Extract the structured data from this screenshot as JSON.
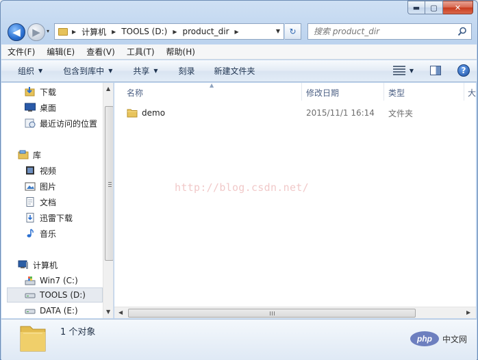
{
  "window": {
    "caption": {
      "minimize": "▬",
      "maximize": "▢",
      "close": "✕"
    }
  },
  "nav": {
    "back_glyph": "◀",
    "forward_glyph": "▶",
    "dropdown_glyph": "▾"
  },
  "address": {
    "segments": [
      "计算机",
      "TOOLS (D:)",
      "product_dir"
    ],
    "separator": "▶",
    "dropdown_glyph": "▼"
  },
  "refresh_glyph": "↻",
  "search": {
    "placeholder": "搜索 product_dir"
  },
  "menubar": {
    "items": [
      "文件(F)",
      "编辑(E)",
      "查看(V)",
      "工具(T)",
      "帮助(H)"
    ]
  },
  "commandbar": {
    "items": [
      {
        "label": "组织",
        "dropdown": true
      },
      {
        "label": "包含到库中",
        "dropdown": true
      },
      {
        "label": "共享",
        "dropdown": true
      },
      {
        "label": "刻录",
        "dropdown": false
      },
      {
        "label": "新建文件夹",
        "dropdown": false
      }
    ],
    "dropdown_glyph": "▼",
    "help_glyph": "?"
  },
  "navpane": {
    "favorites": [
      {
        "label": "下载",
        "icon": "download-folder-icon"
      },
      {
        "label": "桌面",
        "icon": "desktop-icon"
      },
      {
        "label": "最近访问的位置",
        "icon": "recent-places-icon"
      }
    ],
    "libraries": {
      "label": "库",
      "icon": "libraries-icon",
      "items": [
        {
          "label": "视频",
          "icon": "video-library-icon"
        },
        {
          "label": "图片",
          "icon": "pictures-library-icon"
        },
        {
          "label": "文档",
          "icon": "documents-library-icon"
        },
        {
          "label": "迅雷下载",
          "icon": "thunder-download-icon"
        },
        {
          "label": "音乐",
          "icon": "music-library-icon"
        }
      ]
    },
    "computer": {
      "label": "计算机",
      "icon": "computer-icon",
      "items": [
        {
          "label": "Win7 (C:)",
          "icon": "system-drive-icon",
          "selected": false
        },
        {
          "label": "TOOLS (D:)",
          "icon": "drive-icon",
          "selected": true
        },
        {
          "label": "DATA (E:)",
          "icon": "drive-icon",
          "selected": false
        }
      ]
    }
  },
  "filepane": {
    "columns": [
      "名称",
      "修改日期",
      "类型",
      "大"
    ],
    "sort_glyph": "▲",
    "files": [
      {
        "name": "demo",
        "modified": "2015/11/1 16:14",
        "type": "文件夹"
      }
    ],
    "watermark": "http://blog.csdn.net/"
  },
  "scrollbar": {
    "up_glyph": "▲",
    "down_glyph": "▼",
    "left_glyph": "◀",
    "right_glyph": "▶"
  },
  "details": {
    "count": "1 个对象"
  },
  "badge": {
    "php": "php",
    "site": "中文网"
  },
  "colors": {
    "accent": "#2a6fd0",
    "folder": "#e6c25a",
    "selection": "#e6eaf0"
  }
}
